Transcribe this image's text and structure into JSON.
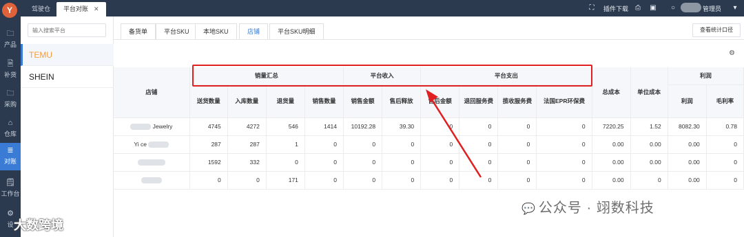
{
  "top_tabs": [
    {
      "label": "驾驶仓"
    },
    {
      "label": "平台对账"
    }
  ],
  "topbar": {
    "plugin_download": "插件下载",
    "admin": "管理员"
  },
  "nav": [
    {
      "icon": "folder-icon",
      "glyph": "🗀",
      "label": "产品"
    },
    {
      "icon": "clipboard-icon",
      "glyph": "🗎",
      "label": "补货"
    },
    {
      "icon": "folder-icon",
      "glyph": "🗀",
      "label": "采购"
    },
    {
      "icon": "store-icon",
      "glyph": "⌂",
      "label": "仓库"
    },
    {
      "icon": "database-icon",
      "glyph": "≣",
      "label": "对账"
    },
    {
      "icon": "clipboard-icon",
      "glyph": "🗒",
      "label": "工作台"
    },
    {
      "icon": "gear-icon",
      "glyph": "⚙",
      "label": "设"
    }
  ],
  "platforms": {
    "search_placeholder": "输入搜索平台",
    "items": [
      "TEMU",
      "SHEIN"
    ]
  },
  "subtabs": [
    "备货单",
    "平台SKU",
    "本地SKU",
    "店铺",
    "平台SKU明细"
  ],
  "stat_button": "查看统计口径",
  "table": {
    "group_headers": {
      "store": "店铺",
      "sales_summary": "销量汇总",
      "platform_income": "平台收入",
      "platform_expense": "平台支出",
      "total_cost": "总成本",
      "unit_cost": "单位成本",
      "profit": "利润"
    },
    "sub_headers": [
      "送货数量",
      "入库数量",
      "退货量",
      "销售数量",
      "销售金额",
      "售后释放",
      "售后金额",
      "退回服务费",
      "揽收服务费",
      "法国EPR环保费",
      "利润",
      "毛利率"
    ],
    "rows": [
      {
        "store": "Jewelry",
        "cells": [
          "4745",
          "4272",
          "546",
          "1414",
          "10192.28",
          "39.30",
          "0",
          "0",
          "0",
          "0",
          "7220.25",
          "1.52",
          "8082.30",
          "0.78"
        ]
      },
      {
        "store": "Yi ce",
        "cells": [
          "287",
          "287",
          "1",
          "0",
          "0",
          "0",
          "0",
          "0",
          "0",
          "0",
          "0.00",
          "0.00",
          "0.00",
          "0"
        ]
      },
      {
        "store": "",
        "cells": [
          "1592",
          "332",
          "0",
          "0",
          "0",
          "0",
          "0",
          "0",
          "0",
          "0",
          "0.00",
          "0.00",
          "0.00",
          "0"
        ]
      },
      {
        "store": "",
        "cells": [
          "0",
          "0",
          "171",
          "0",
          "0",
          "0",
          "0",
          "0",
          "0",
          "0",
          "0.00",
          "0",
          "0.00",
          "0"
        ]
      }
    ]
  },
  "watermarks": {
    "wechat": "公众号 · 翊数科技",
    "brand": "大数跨境"
  },
  "colors": {
    "nav_bg": "#2b3a4f",
    "accent": "#3a7bd5",
    "temu_orange": "#f39c3b",
    "annotation_red": "#e02020"
  }
}
